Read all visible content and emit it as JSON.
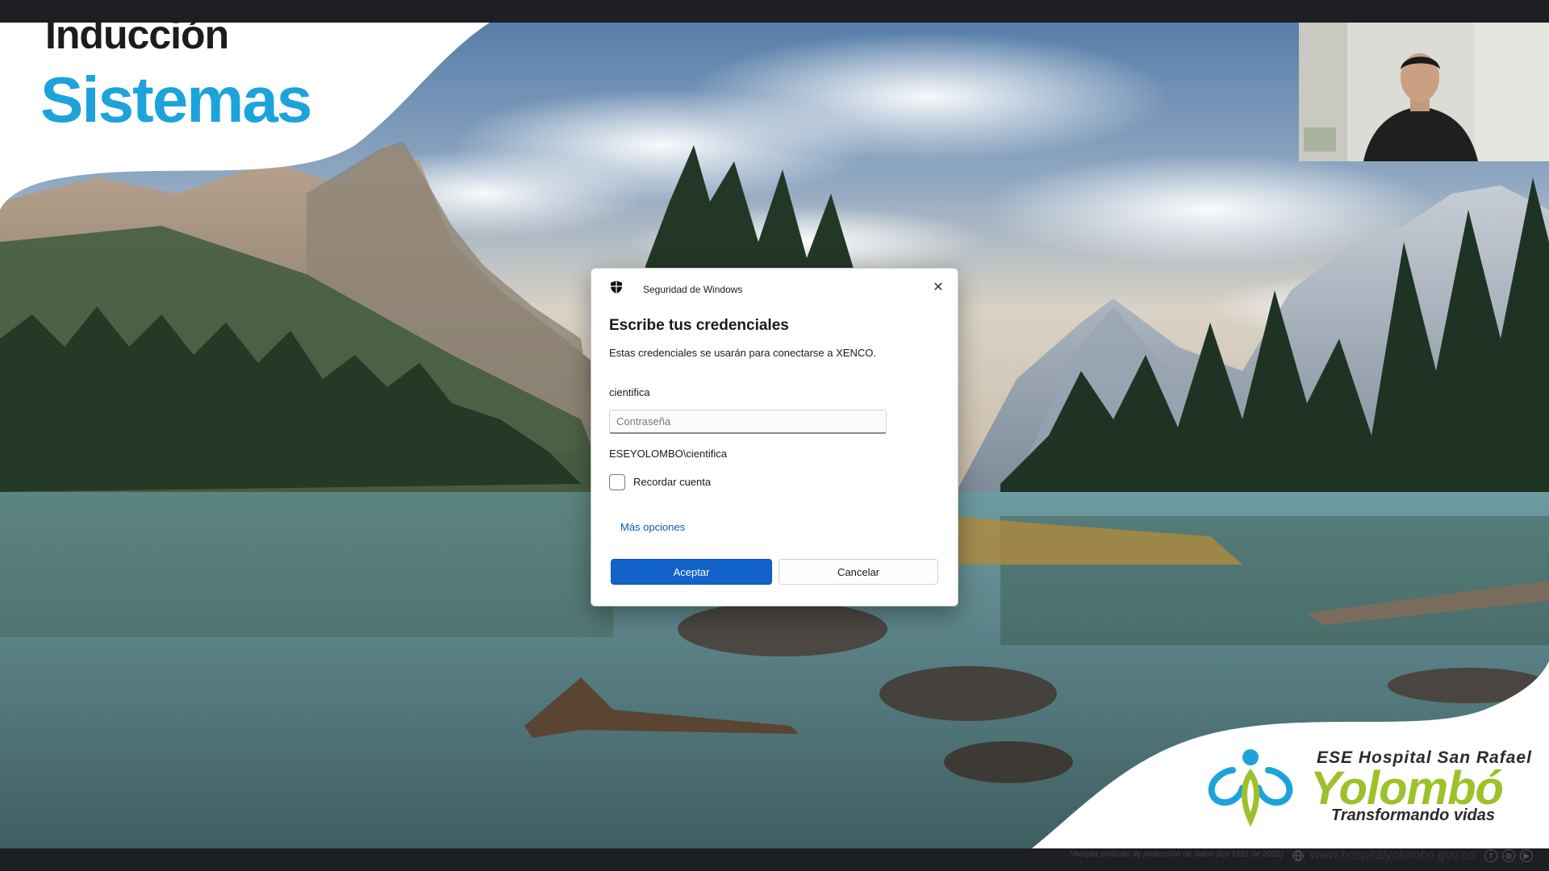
{
  "slide": {
    "title_line1": "Inducción",
    "title_line2": "Sistemas",
    "title_color": "#1c1c1c",
    "accent_color": "#1da3db"
  },
  "dialog": {
    "app_name": "Seguridad de Windows",
    "shield_icon": "shield-icon",
    "close_icon": "close-icon",
    "heading": "Escribe tus credenciales",
    "description": "Estas credenciales se usarán para conectarse a XENCO.",
    "username": "cientifica",
    "password_placeholder": "Contraseña",
    "password_value": "",
    "domain_user": "ESEYOLOMBO\\cientifica",
    "remember_label": "Recordar cuenta",
    "remember_checked": false,
    "more_options": "Más opciones",
    "ok_label": "Aceptar",
    "cancel_label": "Cancelar",
    "primary_color": "#1163c9",
    "link_color": "#0a5bb5"
  },
  "branding": {
    "hospital": "ESE Hospital San Rafael",
    "name": "Yolombó",
    "slogan": "Transformando vidas",
    "footer_note": "*Acepta políticas de protección de datos (ley 1581 de 2002)",
    "url": "www.hospitalyolombo.gov.co",
    "social": [
      "f",
      "◎",
      "▶"
    ],
    "logo_blue": "#1da3db",
    "logo_green": "#9dc12b"
  }
}
